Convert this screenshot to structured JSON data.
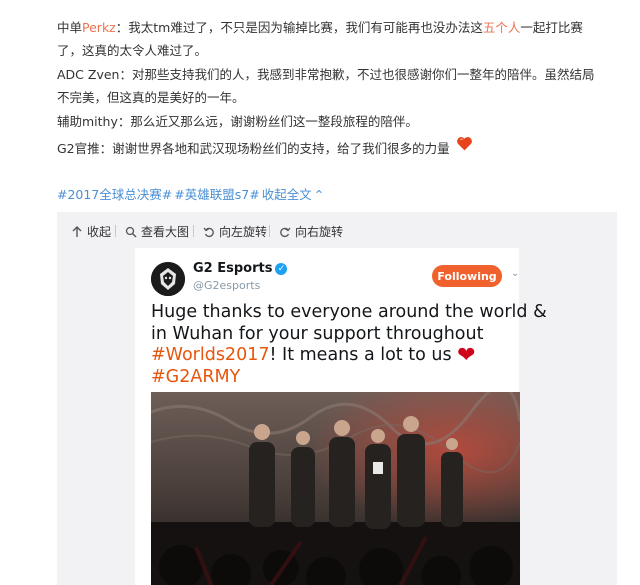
{
  "post": {
    "l1_prefix": "中单",
    "l1_link": "Perkz",
    "l1_text_a": "：我太tm难过了，不只是因为输掉比赛，我们有可能再也没办法这",
    "l1_link2": "五个人",
    "l1_text_b": "一起打比赛",
    "l2": "了，这真的太令人难过了。",
    "l3": "ADC Zven：对那些支持我们的人，我感到非常抱歉，不过也很感谢你们一整年的陪伴。虽然结局",
    "l4": "不完美，但这真的是美好的一年。",
    "l5": "辅助mithy：那么近又那么远，谢谢粉丝们这一整段旅程的陪伴。",
    "l6": "G2官推：谢谢世界各地和武汉现场粉丝们的支持，给了我们很多的力量"
  },
  "tags": {
    "tag1": "#2017全球总决赛#",
    "tag2": "#英雄联盟s7#",
    "collapse": "收起全文"
  },
  "toolbar": {
    "collapse": "收起",
    "view_large": "查看大图",
    "rotate_left": "向左旋转",
    "rotate_right": "向右旋转"
  },
  "tweet": {
    "avatar_text": "G2",
    "name": "G2 Esports",
    "handle": "@G2esports",
    "follow_label": "Following",
    "line1": "Huge thanks to everyone around the world &",
    "line2": "in Wuhan for your support throughout",
    "hashtag1": "#Worlds2017",
    "line3_rest": "! It means a lot to us",
    "hashtag2": "#G2ARMY"
  },
  "colors": {
    "link": "#eb7350",
    "tag": "#4a90d6",
    "follow": "#f0612d",
    "hashtag": "#e8550c"
  }
}
